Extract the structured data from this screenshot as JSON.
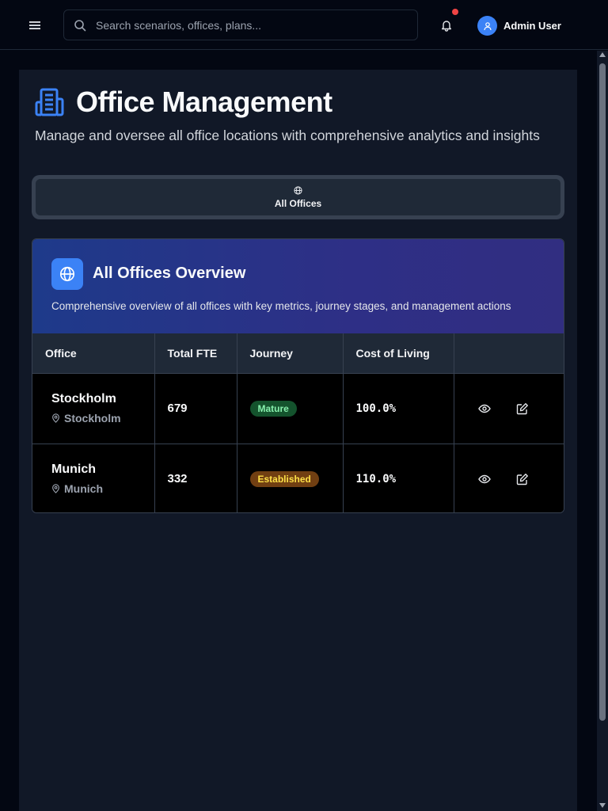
{
  "search": {
    "placeholder": "Search scenarios, offices, plans..."
  },
  "user": {
    "name": "Admin User"
  },
  "page": {
    "title": "Office Management",
    "subtitle": "Manage and oversee all office locations with comprehensive analytics and insights"
  },
  "tabs": [
    {
      "label": "All Offices",
      "icon": "globe-icon"
    }
  ],
  "overview": {
    "title": "All Offices Overview",
    "description": "Comprehensive overview of all offices with key metrics, journey stages, and management actions"
  },
  "table": {
    "headers": [
      "Office",
      "Total FTE",
      "Journey",
      "Cost of Living",
      ""
    ],
    "rows": [
      {
        "office": "Stockholm",
        "location": "Stockholm",
        "fte": "679",
        "journey": "Mature",
        "cost": "100.0%"
      },
      {
        "office": "Munich",
        "location": "Munich",
        "fte": "332",
        "journey": "Established",
        "cost": "110.0%"
      }
    ]
  },
  "colors": {
    "accent": "#3b82f6",
    "notification": "#ef4444",
    "mature_badge": "#14532d",
    "established_badge": "#713f12"
  }
}
